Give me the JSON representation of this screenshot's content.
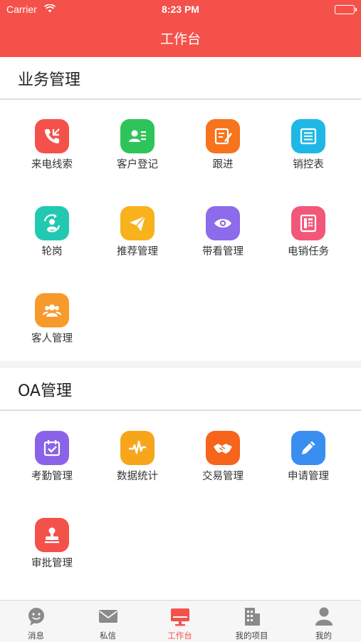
{
  "status_bar": {
    "carrier": "Carrier",
    "time": "8:23 PM"
  },
  "navbar": {
    "title": "工作台"
  },
  "sections": [
    {
      "title": "业务管理",
      "items": [
        {
          "label": "来电线索",
          "icon": "phone-incoming-icon",
          "color": "#f5514b"
        },
        {
          "label": "客户登记",
          "icon": "contact-card-icon",
          "color": "#2ec45a"
        },
        {
          "label": "跟进",
          "icon": "edit-note-icon",
          "color": "#f7731c"
        },
        {
          "label": "销控表",
          "icon": "list-table-icon",
          "color": "#1fb8e6"
        },
        {
          "label": "轮岗",
          "icon": "rotate-user-icon",
          "color": "#22c9b0"
        },
        {
          "label": "推荐管理",
          "icon": "paper-plane-icon",
          "color": "#f7b21c"
        },
        {
          "label": "带看管理",
          "icon": "eye-icon",
          "color": "#8e6bea"
        },
        {
          "label": "电销任务",
          "icon": "desk-phone-icon",
          "color": "#f2577a"
        },
        {
          "label": "客人管理",
          "icon": "group-icon",
          "color": "#f79a2c"
        }
      ]
    },
    {
      "title": "OA管理",
      "items": [
        {
          "label": "考勤管理",
          "icon": "calendar-check-icon",
          "color": "#8a63e8"
        },
        {
          "label": "数据统计",
          "icon": "pulse-chart-icon",
          "color": "#f7a61c"
        },
        {
          "label": "交易管理",
          "icon": "handshake-icon",
          "color": "#f7641c"
        },
        {
          "label": "申请管理",
          "icon": "pencil-icon",
          "color": "#3a8ef0"
        },
        {
          "label": "审批管理",
          "icon": "stamp-icon",
          "color": "#f5514b"
        }
      ]
    }
  ],
  "tabbar": {
    "tabs": [
      {
        "label": "消息",
        "icon": "chat-bubble-icon",
        "active": false
      },
      {
        "label": "私信",
        "icon": "envelope-icon",
        "active": false
      },
      {
        "label": "工作台",
        "icon": "monitor-icon",
        "active": true
      },
      {
        "label": "我的项目",
        "icon": "building-icon",
        "active": false
      },
      {
        "label": "我的",
        "icon": "user-icon",
        "active": false
      }
    ],
    "active_color": "#f5514b",
    "inactive_color": "#8a8a8a"
  }
}
